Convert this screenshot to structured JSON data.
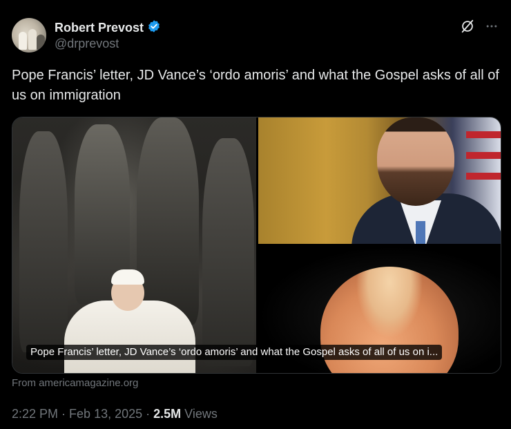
{
  "author": {
    "display_name": "Robert Prevost",
    "handle": "@drprevost",
    "verified": true
  },
  "icons": {
    "verified": "verified-badge-icon",
    "grok": "grok-icon",
    "more": "more-options-icon"
  },
  "colors": {
    "background": "#000000",
    "text_primary": "#e7e9ea",
    "text_secondary": "#71767b",
    "verified_blue": "#1d9bf0",
    "card_border": "#2f3336"
  },
  "tweet": {
    "text": "Pope Francis’ letter, JD Vance’s ‘ordo amoris’ and what the Gospel asks of all of us on immigration"
  },
  "card": {
    "caption": "Pope Francis’ letter, JD Vance’s ‘ordo amoris’ and what the Gospel asks of all of us on i...",
    "source": "From americamagazine.org"
  },
  "meta": {
    "time": "2:22 PM",
    "separator1": " · ",
    "date": "Feb 13, 2025",
    "separator2": " · ",
    "views_count": "2.5M",
    "views_label": " Views"
  }
}
